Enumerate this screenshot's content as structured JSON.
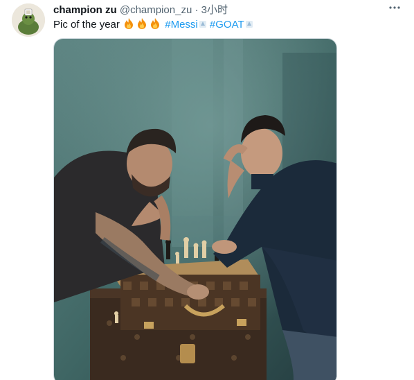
{
  "tweet": {
    "display_name": "champion zu",
    "handle": "@champion_zu",
    "separator": "·",
    "time": "3小时",
    "text_prefix": "Pic of the year",
    "hashtags": [
      "#Messi",
      "#GOAT"
    ],
    "more_icon": "more-horizontal-icon",
    "emoji_icon": "fire-icon"
  },
  "colors": {
    "link": "#1d9bf0",
    "text": "#0f1419",
    "muted": "#536471"
  }
}
